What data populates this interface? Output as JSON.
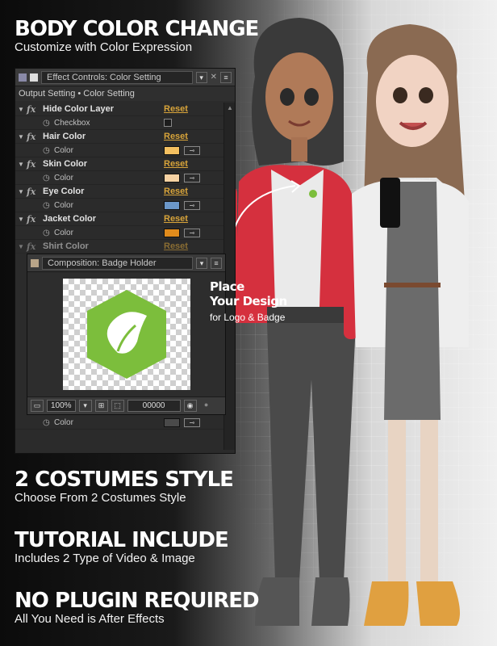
{
  "headings": {
    "h1": {
      "title": "BODY COLOR CHANGE",
      "subtitle": "Customize with Color Expression"
    },
    "h2": {
      "title": "2 COSTUMES STYLE",
      "subtitle": "Choose From 2 Costumes Style"
    },
    "h3": {
      "title": "TUTORIAL INCLUDE",
      "subtitle": "Includes 2 Type of Video & Image"
    },
    "h4": {
      "title": "NO PLUGIN REQUIRED",
      "subtitle": "All You Need is After Effects"
    }
  },
  "effect_controls": {
    "tab_title": "Effect Controls: Color Setting",
    "breadcrumb": "Output Setting • Color Setting",
    "reset_label": "Reset",
    "rows": [
      {
        "name": "Hide Color Layer",
        "sub_label": "Checkbox",
        "type": "checkbox"
      },
      {
        "name": "Hair Color",
        "sub_label": "Color",
        "type": "color",
        "color": "#f4c060"
      },
      {
        "name": "Skin Color",
        "sub_label": "Color",
        "type": "color",
        "color": "#f6d2a3"
      },
      {
        "name": "Eye Color",
        "sub_label": "Color",
        "type": "color",
        "color": "#6b97c9"
      },
      {
        "name": "Jacket Color",
        "sub_label": "Color",
        "type": "color",
        "color": "#e08b1c"
      },
      {
        "name": "Shirt Color",
        "sub_label": "",
        "type": "partial"
      }
    ],
    "bottom_row": {
      "sub_label": "Color",
      "color": "#4a4a4a"
    }
  },
  "composition": {
    "tab_title": "Composition: Badge Holder",
    "zoom": "100%",
    "timecode": "00000",
    "badge_color": "#7cbe3c"
  },
  "place": {
    "line1": "Place",
    "line2": "Your Design",
    "sub": "for Logo & Badge"
  },
  "colors": {
    "jacket_red": "#d5303e",
    "dress_gray": "#6b6b6b",
    "cardigan": "#eeeeee"
  }
}
